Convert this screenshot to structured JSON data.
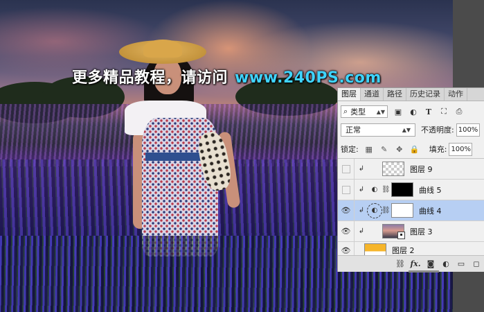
{
  "watermark": {
    "text_zh": "更多精品教程，请访问",
    "url": "www.240PS.com",
    "color_url": "#3fd4ff"
  },
  "layers_panel": {
    "tabs": [
      {
        "label": "图层",
        "active": true
      },
      {
        "label": "通道",
        "active": false
      },
      {
        "label": "路径",
        "active": false
      },
      {
        "label": "历史记录",
        "active": false
      },
      {
        "label": "动作",
        "active": false
      }
    ],
    "filter": {
      "search_icon": "search-icon",
      "label": "类型"
    },
    "filter_icons": [
      "image-filter-icon",
      "adjustment-filter-icon",
      "type-filter-icon",
      "shape-filter-icon",
      "smart-object-filter-icon"
    ],
    "blend_mode": "正常",
    "opacity_label": "不透明度:",
    "opacity_value": "100%",
    "lock_label": "锁定:",
    "fill_label": "填充:",
    "fill_value": "100%",
    "selection_color": "#b7cff3",
    "layers": [
      {
        "name": "图层 9",
        "visible": false,
        "clipped": true,
        "thumb": "transparent",
        "selected": false
      },
      {
        "name": "曲线 5",
        "visible": false,
        "clipped": true,
        "adjustment": true,
        "thumb": "black-mask",
        "selected": false
      },
      {
        "name": "曲线 4",
        "visible": true,
        "clipped": true,
        "adjustment": true,
        "thumb": "white-mask",
        "selected": true
      },
      {
        "name": "图层 3",
        "visible": true,
        "clipped": true,
        "thumb": "sunset-smart",
        "selected": false
      },
      {
        "name": "图层 2",
        "visible": true,
        "clipped": false,
        "thumb": "orange",
        "selected": false
      }
    ],
    "footer_buttons": [
      "link-layers-icon",
      "fx-icon",
      "add-mask-icon",
      "new-adjustment-icon",
      "new-group-icon",
      "new-layer-icon"
    ],
    "footer_fx": "fx."
  }
}
